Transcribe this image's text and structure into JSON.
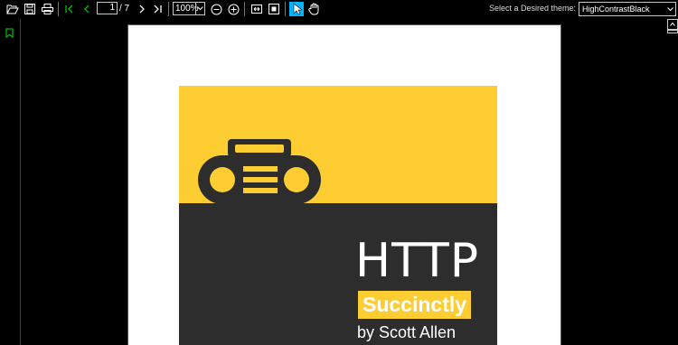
{
  "toolbar": {
    "page": {
      "current": "1",
      "total_label": "/ 7"
    },
    "zoom": {
      "value": "100%"
    },
    "theme": {
      "label": "Select a Desired theme:",
      "selected": "HighContrastBlack"
    },
    "icons": [
      "open-folder-icon",
      "save-icon",
      "print-icon",
      "first-page-icon",
      "previous-page-icon",
      "next-page-icon",
      "last-page-icon",
      "zoom-out-icon",
      "zoom-in-icon",
      "fit-page-icon",
      "fit-width-icon",
      "select-tool-icon",
      "pan-hand-icon"
    ],
    "colors": {
      "accent": "#00b4ff",
      "nav_green": "#00c000"
    }
  },
  "sidebar": {
    "icons": [
      "bookmark-icon"
    ]
  },
  "document": {
    "cover": {
      "title": "HTTP",
      "subtitle": "Succinctly",
      "author": "by Scott Allen",
      "colors": {
        "yellow": "#fecd32",
        "dark": "#2d2d2d"
      }
    }
  }
}
